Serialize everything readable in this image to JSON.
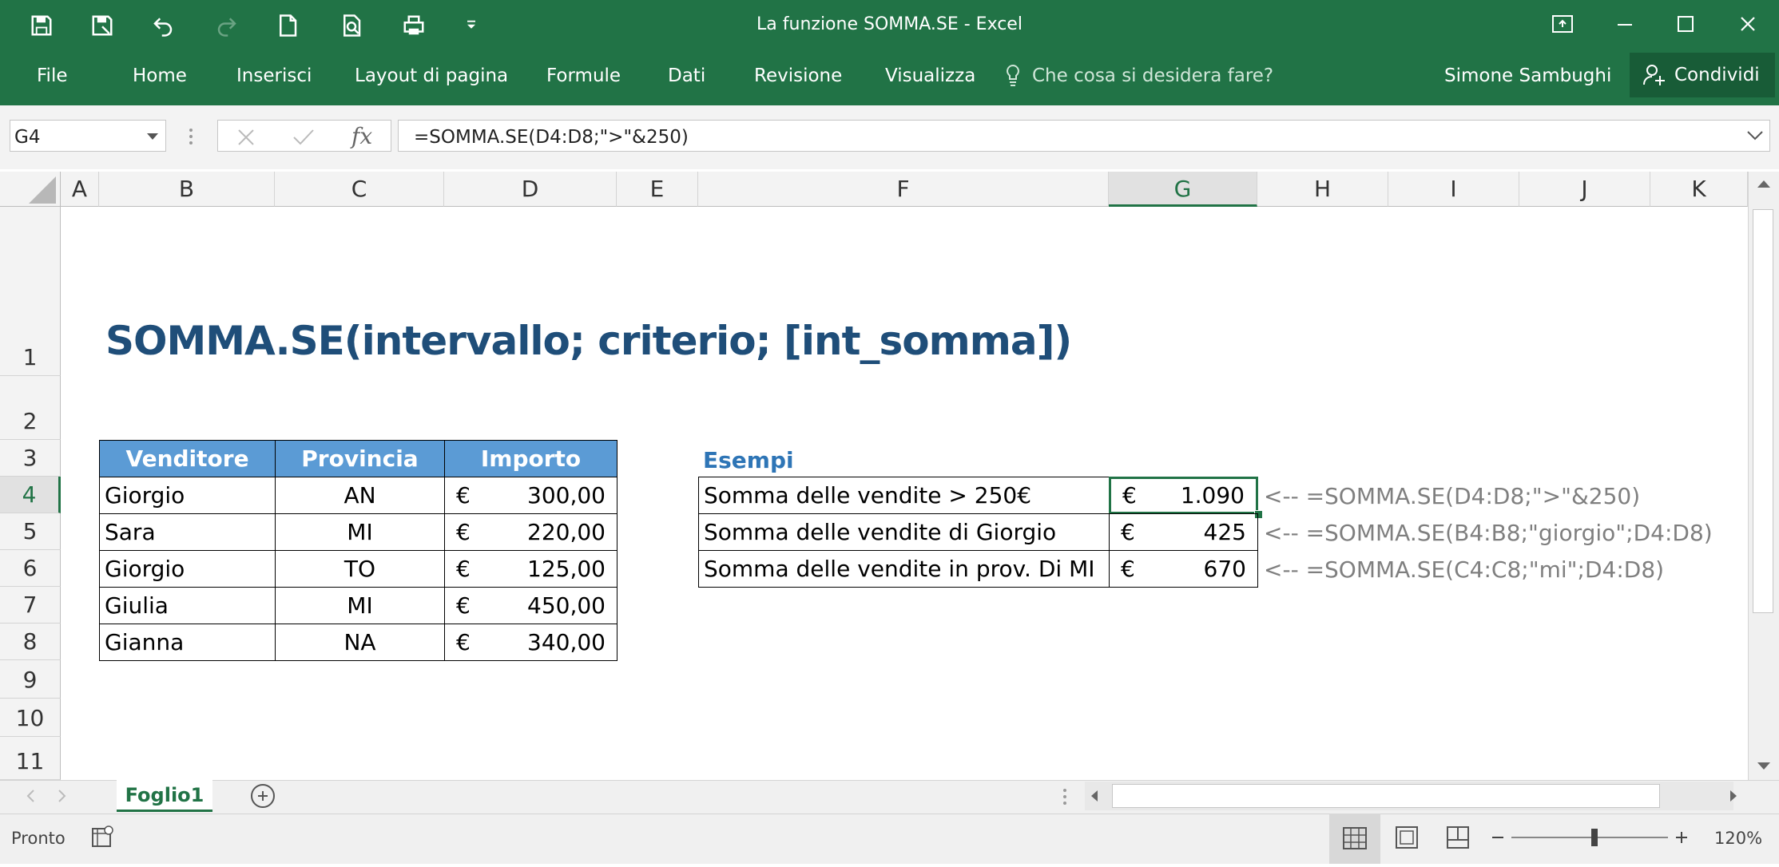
{
  "window": {
    "title": "La funzione SOMMA.SE - Excel",
    "quick_access": [
      "save-icon",
      "save-as-icon",
      "undo-icon",
      "redo-icon",
      "new-file-icon",
      "print-preview-icon",
      "quick-print-icon",
      "customize-dropdown-icon"
    ],
    "controls": [
      "ribbon-display-icon",
      "minimize-icon",
      "maximize-icon",
      "close-icon"
    ]
  },
  "ribbon": {
    "tabs": [
      "File",
      "Home",
      "Inserisci",
      "Layout di pagina",
      "Formule",
      "Dati",
      "Revisione",
      "Visualizza"
    ],
    "tell_me": "Che cosa si desidera fare?",
    "user": "Simone Sambughi",
    "share": "Condividi"
  },
  "formula_bar": {
    "name_box": "G4",
    "fx": "fx",
    "formula": "=SOMMA.SE(D4:D8;\">\"&250)"
  },
  "sheet": {
    "columns": [
      "A",
      "B",
      "C",
      "D",
      "E",
      "F",
      "G",
      "H",
      "I",
      "J",
      "K"
    ],
    "selected_column": "G",
    "rows": [
      "1",
      "2",
      "3",
      "4",
      "5",
      "6",
      "7",
      "8",
      "9",
      "10",
      "11"
    ],
    "selected_row": "4",
    "title": "SOMMA.SE(intervallo; criterio; [int_somma])",
    "table_headers": [
      "Venditore",
      "Provincia",
      "Importo"
    ],
    "table_rows": [
      {
        "venditore": "Giorgio",
        "provincia": "AN",
        "valuta": "€",
        "importo": "300,00"
      },
      {
        "venditore": "Sara",
        "provincia": "MI",
        "valuta": "€",
        "importo": "220,00"
      },
      {
        "venditore": "Giorgio",
        "provincia": "TO",
        "valuta": "€",
        "importo": "125,00"
      },
      {
        "venditore": "Giulia",
        "provincia": "MI",
        "valuta": "€",
        "importo": "450,00"
      },
      {
        "venditore": "Gianna",
        "provincia": "NA",
        "valuta": "€",
        "importo": "340,00"
      }
    ],
    "examples_label": "Esempi",
    "examples": [
      {
        "label": "Somma delle vendite > 250€",
        "valuta": "€",
        "value": "1.090",
        "formula": "<-- =SOMMA.SE(D4:D8;\">\"&250)"
      },
      {
        "label": "Somma delle vendite di Giorgio",
        "valuta": "€",
        "value": "425",
        "formula": "<-- =SOMMA.SE(B4:B8;\"giorgio\";D4:D8)"
      },
      {
        "label": "Somma delle vendite in prov. Di MI",
        "valuta": "€",
        "value": "670",
        "formula": "<-- =SOMMA.SE(C4:C8;\"mi\";D4:D8)"
      }
    ]
  },
  "tabs_bar": {
    "sheet_tab": "Foglio1"
  },
  "status": {
    "text": "Pronto",
    "zoom": "120%"
  },
  "colors": {
    "excel_green": "#217346",
    "table_header": "#5b9bd5",
    "title_color": "#1f4e79",
    "esempi_color": "#2e75b6"
  }
}
